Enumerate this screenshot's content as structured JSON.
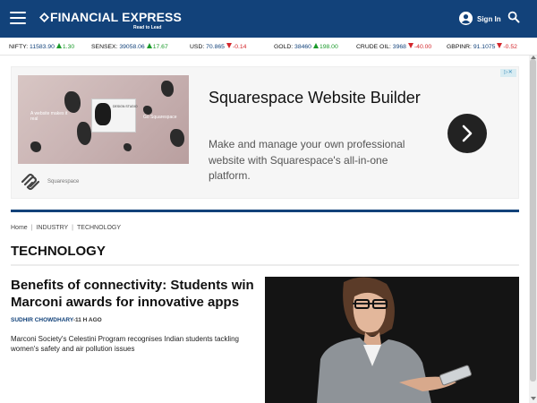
{
  "header": {
    "logo_text": "FINANCIAL EXPRESS",
    "logo_tagline": "Read to Lead",
    "signin_label": "Sign In",
    "colors": {
      "bar": "#12427a",
      "text": "#ffffff"
    }
  },
  "ticker": [
    {
      "name": "NIFTY:",
      "value": "11583.90",
      "change": "1.30",
      "direction": "up"
    },
    {
      "name": "SENSEX:",
      "value": "39058.06",
      "change": "17.67",
      "direction": "up"
    },
    {
      "name": "USD:",
      "value": "70.865",
      "change": "-0.14",
      "direction": "down"
    },
    {
      "name": "GOLD:",
      "value": "38460",
      "change": "198.00",
      "direction": "up"
    },
    {
      "name": "CRUDE OIL:",
      "value": "3968",
      "change": "-40.00",
      "direction": "down"
    },
    {
      "name": "GBPINR:",
      "value": "91.1075",
      "change": "-0.52",
      "direction": "down"
    }
  ],
  "ad": {
    "title": "Squarespace Website Builder",
    "description": "Make and manage your own professional website with Squarespace's all-in-one platform.",
    "brand": "Squarespace",
    "image_caption_left": "A website makes it real",
    "image_caption_right": "Go Squarespace",
    "image_panel_text": "DESIGN STUDIO",
    "adchoices": "▷✕"
  },
  "breadcrumb": {
    "items": [
      "Home",
      "INDUSTRY",
      "TECHNOLOGY"
    ],
    "separator": "|"
  },
  "section": {
    "title": "TECHNOLOGY"
  },
  "article": {
    "headline": "Benefits of connectivity: Students win Marconi awards for innovative apps",
    "author": "SUDHIR CHOWDHARY",
    "time": "-11 H AGO",
    "summary": "Marconi Society's Celestini Program recognises Indian students tackling women's safety and air pollution issues"
  }
}
